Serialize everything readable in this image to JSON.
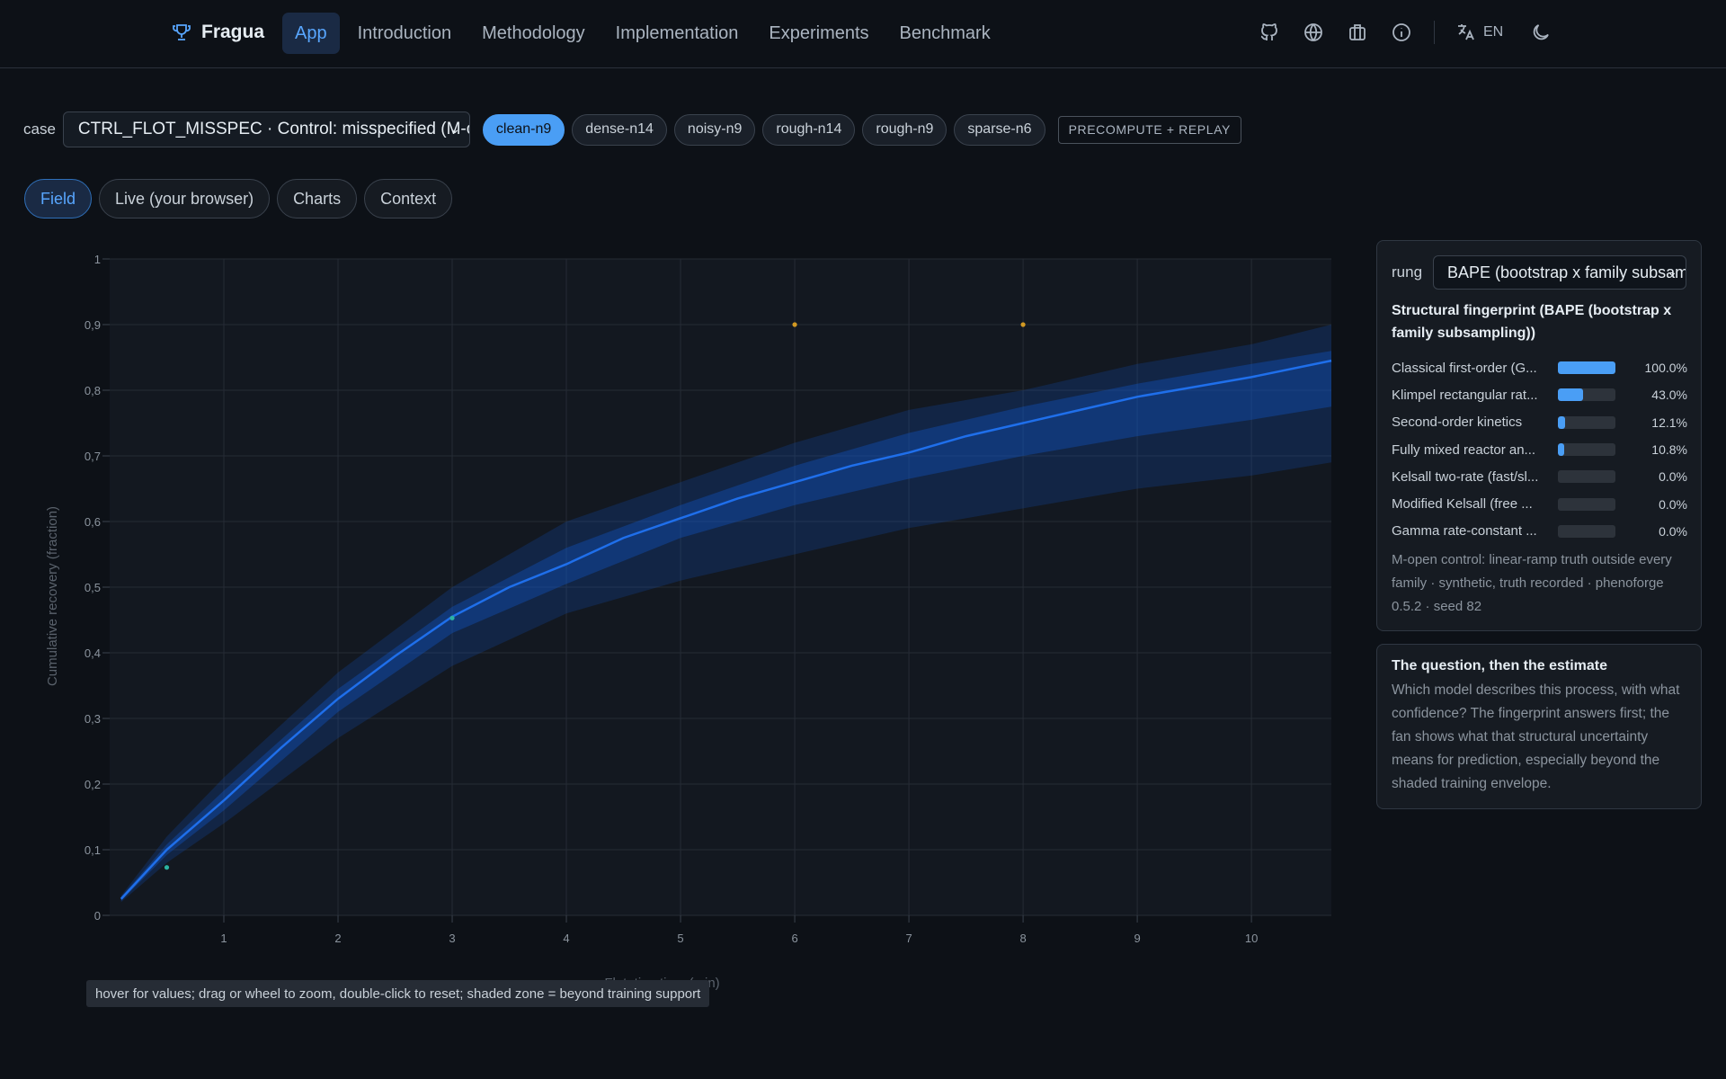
{
  "header": {
    "brand": "Fragua",
    "nav": [
      "App",
      "Introduction",
      "Methodology",
      "Implementation",
      "Experiments",
      "Benchmark"
    ],
    "active_nav": "App",
    "lang": "EN",
    "icons": [
      "github-icon",
      "globe-icon",
      "briefcase-icon",
      "info-icon",
      "translate-icon",
      "moon-icon"
    ]
  },
  "case": {
    "label": "case",
    "selected": "CTRL_FLOT_MISSPEC · Control: misspecified (M-open)",
    "chips": [
      "clean-n9",
      "dense-n14",
      "noisy-n9",
      "rough-n14",
      "rough-n9",
      "sparse-n6"
    ],
    "active_chip": "clean-n9",
    "replay_label": "PRECOMPUTE + REPLAY"
  },
  "tabs": [
    "Field",
    "Live (your browser)",
    "Charts",
    "Context"
  ],
  "active_tab": "Field",
  "hint": "hover for values; drag or wheel to zoom, double-click to reset; shaded zone = beyond training support",
  "chart_data": {
    "type": "line",
    "xlabel": "Flotation time (min)",
    "ylabel": "Cumulative recovery (fraction)",
    "xlim": [
      0,
      10.7
    ],
    "ylim": [
      0,
      1
    ],
    "xticks": [
      1,
      2,
      3,
      4,
      5,
      6,
      7,
      8,
      9,
      10
    ],
    "yticks": [
      0,
      0.1,
      0.2,
      0.3,
      0.4,
      0.5,
      0.6,
      0.7,
      0.8,
      0.9,
      1
    ],
    "ytick_labels": [
      "0",
      "0,1",
      "0,2",
      "0,3",
      "0,4",
      "0,5",
      "0,6",
      "0,7",
      "0,8",
      "0,9",
      "1"
    ],
    "median": {
      "x": [
        0.1,
        0.5,
        1,
        1.5,
        2,
        2.5,
        3,
        3.5,
        4,
        4.5,
        5,
        5.5,
        6,
        6.5,
        7,
        7.5,
        8,
        8.5,
        9,
        9.5,
        10,
        10.7
      ],
      "y": [
        0.025,
        0.1,
        0.175,
        0.255,
        0.33,
        0.395,
        0.455,
        0.5,
        0.535,
        0.575,
        0.605,
        0.635,
        0.66,
        0.685,
        0.705,
        0.73,
        0.75,
        0.77,
        0.79,
        0.805,
        0.82,
        0.845
      ]
    },
    "band_outer": {
      "x": [
        0.1,
        0.5,
        1,
        2,
        3,
        4,
        5,
        6,
        7,
        8,
        9,
        10,
        10.7
      ],
      "upper": [
        0.03,
        0.12,
        0.21,
        0.37,
        0.5,
        0.6,
        0.66,
        0.72,
        0.77,
        0.8,
        0.84,
        0.87,
        0.9
      ],
      "lower": [
        0.02,
        0.08,
        0.14,
        0.27,
        0.38,
        0.46,
        0.51,
        0.55,
        0.59,
        0.62,
        0.65,
        0.67,
        0.69
      ]
    },
    "band_inner": {
      "x": [
        0.1,
        0.5,
        1,
        2,
        3,
        4,
        5,
        6,
        7,
        8,
        9,
        10,
        10.7
      ],
      "upper": [
        0.028,
        0.108,
        0.19,
        0.345,
        0.47,
        0.56,
        0.625,
        0.685,
        0.735,
        0.775,
        0.81,
        0.84,
        0.86
      ],
      "lower": [
        0.022,
        0.092,
        0.16,
        0.31,
        0.43,
        0.505,
        0.575,
        0.625,
        0.665,
        0.7,
        0.73,
        0.755,
        0.775
      ]
    },
    "observed_points": [
      {
        "x": 0.5,
        "y": 0.073,
        "kind": "train"
      },
      {
        "x": 3,
        "y": 0.453,
        "kind": "train"
      },
      {
        "x": 6,
        "y": 0.9,
        "kind": "holdout"
      },
      {
        "x": 8,
        "y": 0.9,
        "kind": "holdout"
      }
    ],
    "colors": {
      "median": "#1f6feb",
      "band": "#1158c7",
      "train_point": "#2bb3a3",
      "holdout_point": "#d29922"
    }
  },
  "panel": {
    "rung_label": "rung",
    "rung_selected": "BAPE (bootstrap x family subsampling)",
    "fingerprint_title": "Structural fingerprint (BAPE (bootstrap x family subsampling))",
    "families": [
      {
        "name": "Classical first-order (G...",
        "pct_label": "100.0%",
        "value": 1.0
      },
      {
        "name": "Klimpel rectangular rat...",
        "pct_label": "43.0%",
        "value": 0.43
      },
      {
        "name": "Second-order kinetics",
        "pct_label": "12.1%",
        "value": 0.121
      },
      {
        "name": "Fully mixed reactor an...",
        "pct_label": "10.8%",
        "value": 0.108
      },
      {
        "name": "Kelsall two-rate (fast/sl...",
        "pct_label": "0.0%",
        "value": 0
      },
      {
        "name": "Modified Kelsall (free ...",
        "pct_label": "0.0%",
        "value": 0
      },
      {
        "name": "Gamma rate-constant ...",
        "pct_label": "0.0%",
        "value": 0
      }
    ],
    "note": "M-open control: linear-ramp truth outside every family · synthetic, truth recorded · phenoforge 0.5.2 · seed 82"
  },
  "question": {
    "title": "The question, then the estimate",
    "body": "Which model describes this process, with what confidence? The fingerprint answers first; the fan shows what that structural uncertainty means for prediction, especially beyond the shaded training envelope."
  }
}
